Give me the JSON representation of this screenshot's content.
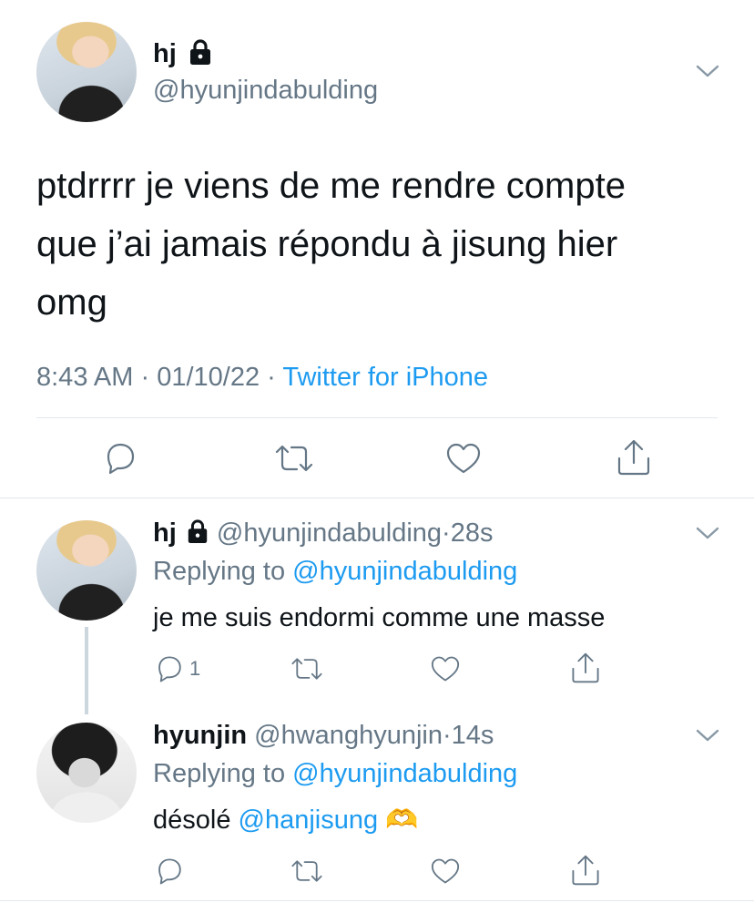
{
  "main_tweet": {
    "display_name": "hj",
    "handle": "@hyunjindabulding",
    "text_line1": "ptdrrrr je viens de me rendre compte",
    "text_line2": "que j’ai jamais répondu à jisung hier",
    "text_line3": "omg",
    "time": "8:43 AM",
    "dot": "·",
    "date": "01/10/22",
    "source": "Twitter for iPhone"
  },
  "reply1": {
    "display_name": "hj",
    "handle": "@hyunjindabulding",
    "dot": "·",
    "age": "28s",
    "replying_prefix": "Replying to",
    "replying_to": "@hyunjindabulding",
    "text": "je me suis endormi comme une masse",
    "reply_count": "1"
  },
  "reply2": {
    "display_name": "hyunjin",
    "handle": "@hwanghyunjin",
    "dot": "·",
    "age": "14s",
    "replying_prefix": "Replying to",
    "replying_to": "@hyunjindabulding",
    "text": "désolé",
    "mention": "@hanjisung",
    "emoji": "🫶"
  },
  "icons": {
    "lock": "lock-icon",
    "caret": "chevron-down-icon",
    "reply": "reply-icon",
    "retweet": "retweet-icon",
    "like": "heart-icon",
    "share": "share-icon"
  },
  "colors": {
    "accent": "#1d9bf0",
    "secondary_text": "#657786",
    "primary_text": "#0f1419",
    "divider": "#e1e8ed"
  }
}
